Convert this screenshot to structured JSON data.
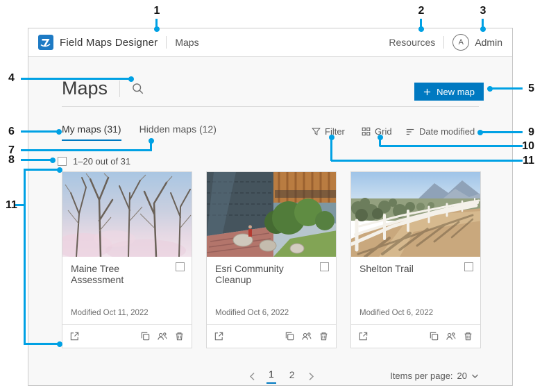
{
  "callouts": {
    "color": "#00a1e4",
    "labels": [
      "1",
      "2",
      "3",
      "4",
      "5",
      "6",
      "7",
      "8",
      "9",
      "10",
      "11",
      "11"
    ]
  },
  "header": {
    "app_title": "Field Maps Designer",
    "nav_current": "Maps",
    "resources_label": "Resources",
    "avatar_initial": "A",
    "user_label": "Admin"
  },
  "toolbar": {
    "page_title": "Maps",
    "new_map_label": "New map"
  },
  "tabs": {
    "my_maps_label": "My maps (31)",
    "hidden_maps_label": "Hidden maps (12)"
  },
  "list_controls": {
    "filter_label": "Filter",
    "grid_label": "Grid",
    "sort_label": "Date modified"
  },
  "selection": {
    "range_label": "1–20 out of 31"
  },
  "cards": [
    {
      "title": "Maine Tree Assessment",
      "modified": "Modified Oct 11, 2022"
    },
    {
      "title": "Esri Community Cleanup",
      "modified": "Modified Oct 6, 2022"
    },
    {
      "title": "Shelton Trail",
      "modified": "Modified Oct 6, 2022"
    }
  ],
  "pagination": {
    "pages": [
      "1",
      "2"
    ],
    "active_page": "1"
  },
  "items_per_page": {
    "label": "Items per page:",
    "value": "20"
  },
  "colors": {
    "accent_blue": "#0079c1",
    "callout_blue": "#00a1e4",
    "content_bg": "#f8f8f8"
  },
  "icons": [
    "esri-logo",
    "search",
    "plus",
    "filter-funnel",
    "grid",
    "sort-lines",
    "checkbox",
    "chevron-left",
    "chevron-right",
    "chevron-down",
    "launch",
    "duplicate",
    "group",
    "trash"
  ]
}
